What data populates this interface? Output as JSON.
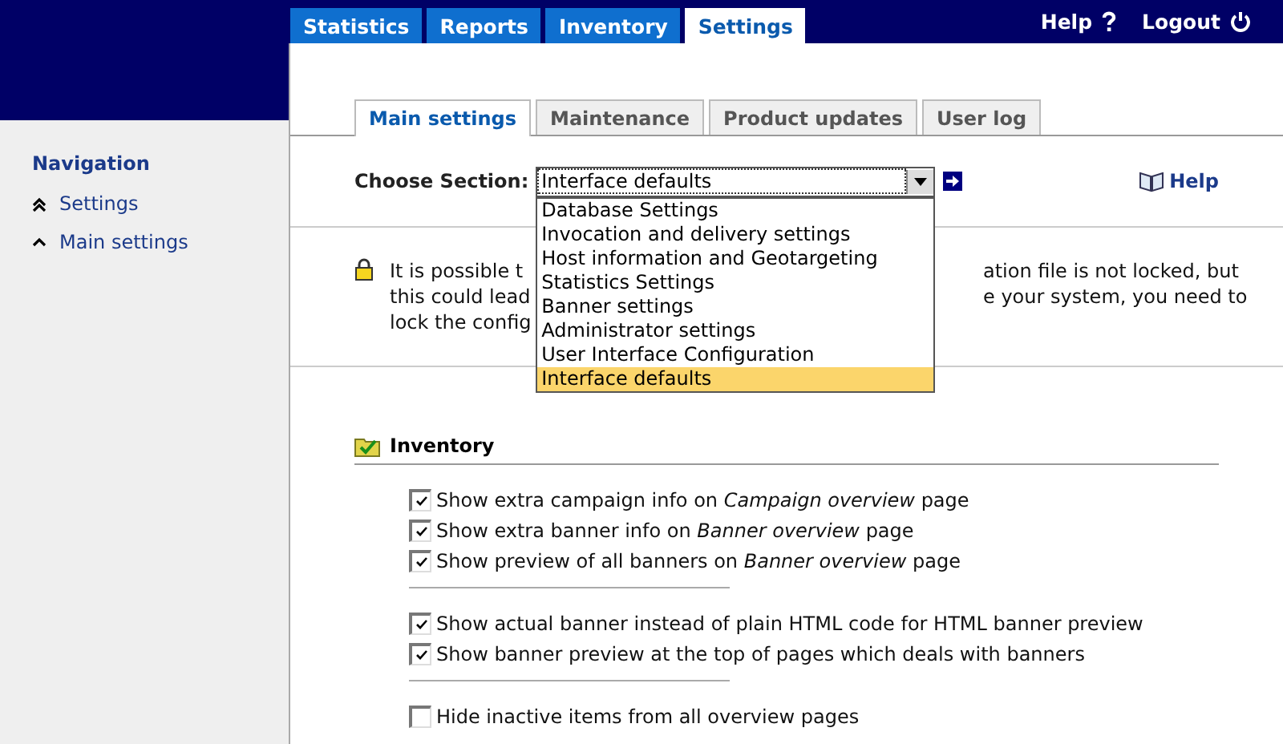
{
  "top_tabs": [
    {
      "label": "Statistics",
      "selected": false
    },
    {
      "label": "Reports",
      "selected": false
    },
    {
      "label": "Inventory",
      "selected": false
    },
    {
      "label": "Settings",
      "selected": true
    }
  ],
  "top_links": [
    {
      "label": "Help"
    },
    {
      "label": "Logout"
    }
  ],
  "sidebar": {
    "title": "Navigation",
    "items": [
      {
        "label": "Settings"
      },
      {
        "label": "Main settings"
      }
    ]
  },
  "sub_tabs": [
    {
      "label": "Main settings",
      "selected": true
    },
    {
      "label": "Maintenance",
      "selected": false
    },
    {
      "label": "Product updates",
      "selected": false
    },
    {
      "label": "User log",
      "selected": false
    }
  ],
  "section": {
    "label": "Choose Section:",
    "value": "Interface defaults",
    "expanded": true,
    "help": "Help",
    "options": [
      {
        "label": "Database Settings",
        "selected": false
      },
      {
        "label": "Invocation and delivery settings",
        "selected": false
      },
      {
        "label": "Host information and Geotargeting",
        "selected": false
      },
      {
        "label": "Statistics Settings",
        "selected": false
      },
      {
        "label": "Banner settings",
        "selected": false
      },
      {
        "label": "Administrator settings",
        "selected": false
      },
      {
        "label": "User Interface Configuration",
        "selected": false
      },
      {
        "label": "Interface defaults",
        "selected": true
      }
    ]
  },
  "notice": {
    "lines": [
      {
        "left": "It is possible t",
        "right": "ation file is not locked, but"
      },
      {
        "left": "this could lead",
        "right": "e your system, you need to"
      },
      {
        "left": "lock the config"
      }
    ]
  },
  "group": {
    "title": "Inventory",
    "blocks": [
      [
        {
          "label": "Show extra campaign info on *Campaign overview* page",
          "checked": true
        },
        {
          "label": "Show extra banner info on *Banner overview* page",
          "checked": true
        },
        {
          "label": "Show preview of all banners on *Banner overview* page",
          "checked": true
        }
      ],
      [
        {
          "label": "Show actual banner instead of plain HTML code for HTML banner preview",
          "checked": true
        },
        {
          "label": "Show banner preview at the top of pages which deals with banners",
          "checked": true
        }
      ],
      [
        {
          "label": "Hide inactive items from all overview pages",
          "checked": false
        }
      ]
    ]
  }
}
